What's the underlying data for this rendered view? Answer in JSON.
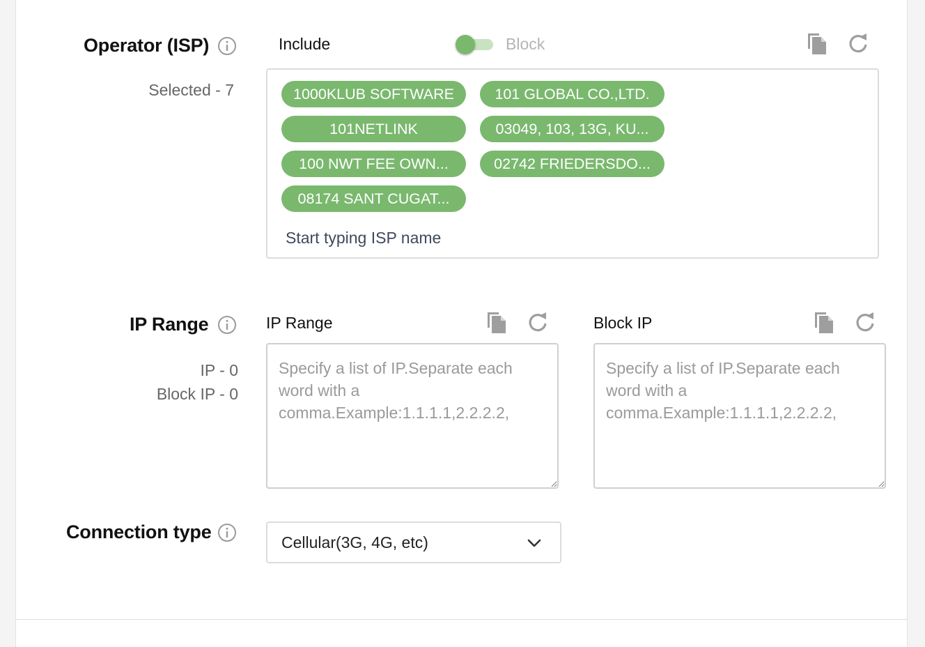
{
  "isp": {
    "label": "Operator (ISP)",
    "selected_text": "Selected - 7",
    "include_label": "Include",
    "block_label": "Block",
    "toggle_state": "include",
    "tags": [
      "1000KLUB SOFTWARE",
      "101 GLOBAL CO.,LTD.",
      "101NETLINK",
      "03049, 103, 13G, KU...",
      "100 NWT FEE OWN...",
      "02742 FRIEDERSDO...",
      "08174 SANT CUGAT..."
    ],
    "input_placeholder": "Start typing ISP name",
    "accent_color": "#7ab86e"
  },
  "ip_range": {
    "label": "IP Range",
    "ip_count": "IP - 0",
    "block_ip_count": "Block IP - 0",
    "range_field_label": "IP Range",
    "block_field_label": "Block IP",
    "range_placeholder": "Specify a list of IP.Separate each word with a comma.Example:1.1.1.1,2.2.2.2,",
    "block_placeholder": "Specify a list of IP.Separate each word with a comma.Example:1.1.1.1,2.2.2.2,"
  },
  "connection": {
    "label": "Connection type",
    "selected": "Cellular(3G, 4G, etc)"
  },
  "icons": {
    "info": "info-icon",
    "copy": "copy-icon",
    "reset": "refresh-icon",
    "dropdown": "chevron-down-icon"
  }
}
